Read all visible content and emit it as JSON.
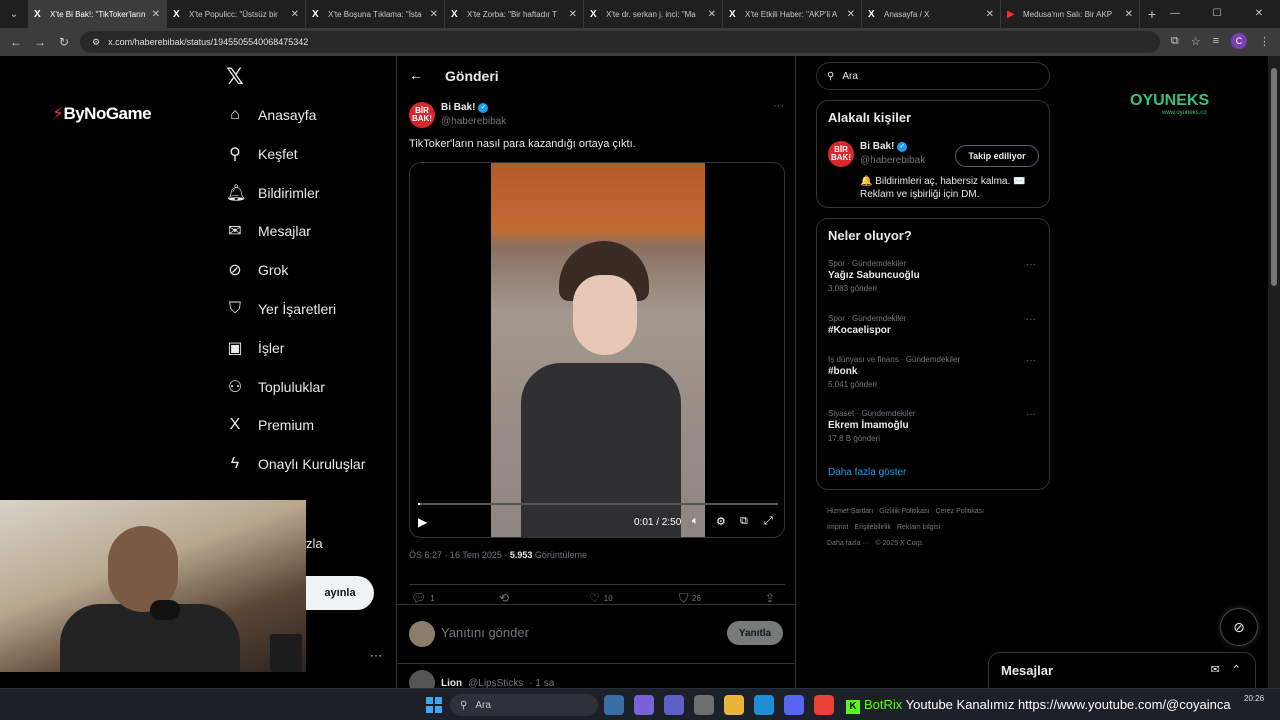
{
  "browser": {
    "tabs": [
      {
        "icon": "X",
        "title": "X'te Bi Bak!: \"TikToker'ların",
        "active": true
      },
      {
        "icon": "X",
        "title": "X'te Populicc: \"Üstsüz bir",
        "active": false
      },
      {
        "icon": "X",
        "title": "X'te Boşuna Tıklama: \"İsta",
        "active": false
      },
      {
        "icon": "X",
        "title": "X'te Zorba: \"Bir haftadır T",
        "active": false
      },
      {
        "icon": "X",
        "title": "X'te dr. serkan j. inci: \"Ma",
        "active": false
      },
      {
        "icon": "X",
        "title": "X'te Etkili Haber: \"AKP'li A",
        "active": false
      },
      {
        "icon": "X",
        "title": "Anasayfa / X",
        "active": false
      },
      {
        "icon": "▶",
        "title": "Medusa'nın Salı: Bir AKP",
        "active": false
      }
    ],
    "url": "x.com/haberebibak/status/1945505540068475342"
  },
  "overlays": {
    "logo_left": "ByNoGame",
    "logo_right": "OYUNEKS",
    "logo_right_sub": "www.oyuneks.co",
    "partial_label": "zla",
    "partial_button": "ayınla"
  },
  "sidebar": {
    "items": [
      {
        "icon": "home-icon",
        "glyph": "⌂",
        "label": "Anasayfa"
      },
      {
        "icon": "search-icon",
        "glyph": "⚲",
        "label": "Keşfet"
      },
      {
        "icon": "bell-icon",
        "glyph": "🔔︎",
        "label": "Bildirimler"
      },
      {
        "icon": "mail-icon",
        "glyph": "✉",
        "label": "Mesajlar"
      },
      {
        "icon": "grok-icon",
        "glyph": "⊘",
        "label": "Grok"
      },
      {
        "icon": "bookmark-icon",
        "glyph": "⛉",
        "label": "Yer İşaretleri"
      },
      {
        "icon": "briefcase-icon",
        "glyph": "▣",
        "label": "İşler"
      },
      {
        "icon": "communities-icon",
        "glyph": "⚇",
        "label": "Topluluklar"
      },
      {
        "icon": "x-premium-icon",
        "glyph": "X",
        "label": "Premium"
      },
      {
        "icon": "lightning-icon",
        "glyph": "ϟ",
        "label": "Onaylı Kuruluşlar"
      }
    ]
  },
  "header": {
    "title": "Gönderi"
  },
  "post": {
    "author_name": "Bi Bak!",
    "author_handle": "@haberebibak",
    "avatar_text": "BİR BAK!",
    "text": "TikToker'ların nasıl para kazandığı ortaya çıktı.",
    "video": {
      "time": "0:01 / 2:50",
      "progress": 0.006
    },
    "meta_time": "ÖS 6:27 · 16 Tem 2025 · ",
    "views_count": "5.953",
    "views_label": " Görüntüleme",
    "replies": "1",
    "reposts": "",
    "likes": "10",
    "bookmarks": "26"
  },
  "reply_box": {
    "placeholder": "Yanıtını gönder",
    "button": "Yanıtla"
  },
  "first_reply": {
    "name": "Lion",
    "handle": "@LipsSticks",
    "time": "· 1 sa"
  },
  "search": {
    "placeholder": "Ara"
  },
  "relevant": {
    "title": "Alakalı kişiler",
    "name": "Bi Bak!",
    "handle": "@haberebibak",
    "follow_label": "Takip ediliyor",
    "bio": "🔔 Bildirimleri aç, habersiz kalma. ✉️ Reklam ve işbirliği için DM."
  },
  "trends": {
    "title": "Neler oluyor?",
    "items": [
      {
        "category": "Spor · Gündemdekiler",
        "name": "Yağız Sabuncuoğlu",
        "count": "3.083 gönderi"
      },
      {
        "category": "Spor · Gündemdekiler",
        "name": "#Kocaelispor",
        "count": ""
      },
      {
        "category": "İş dünyası ve finans · Gündemdekiler",
        "name": "#bonk",
        "count": "5.041 gönderi"
      },
      {
        "category": "Siyaset · Gündemdekiler",
        "name": "Ekrem İmamoğlu",
        "count": "17,8 B gönderi"
      }
    ],
    "show_more": "Daha fazla göster"
  },
  "footer": {
    "links": [
      "Hizmet Şartları",
      "Gizlilik Politikası",
      "Çerez Politikası",
      "Imprint",
      "Erişilebilirlik",
      "Reklam bilgisi",
      "Daha fazla ···",
      "© 2025 X Corp."
    ]
  },
  "messages_drawer": {
    "title": "Mesajlar"
  },
  "taskbar": {
    "search_placeholder": "Ara",
    "ticker_prefix": "BotRix",
    "ticker_text": " Youtube Kanalımız https://www.youtube.com/@coyainca",
    "time": "20:26"
  },
  "colors": {
    "accent": "#1d9bf0",
    "background": "#000000",
    "border": "#2f3336",
    "muted": "#71767b"
  }
}
